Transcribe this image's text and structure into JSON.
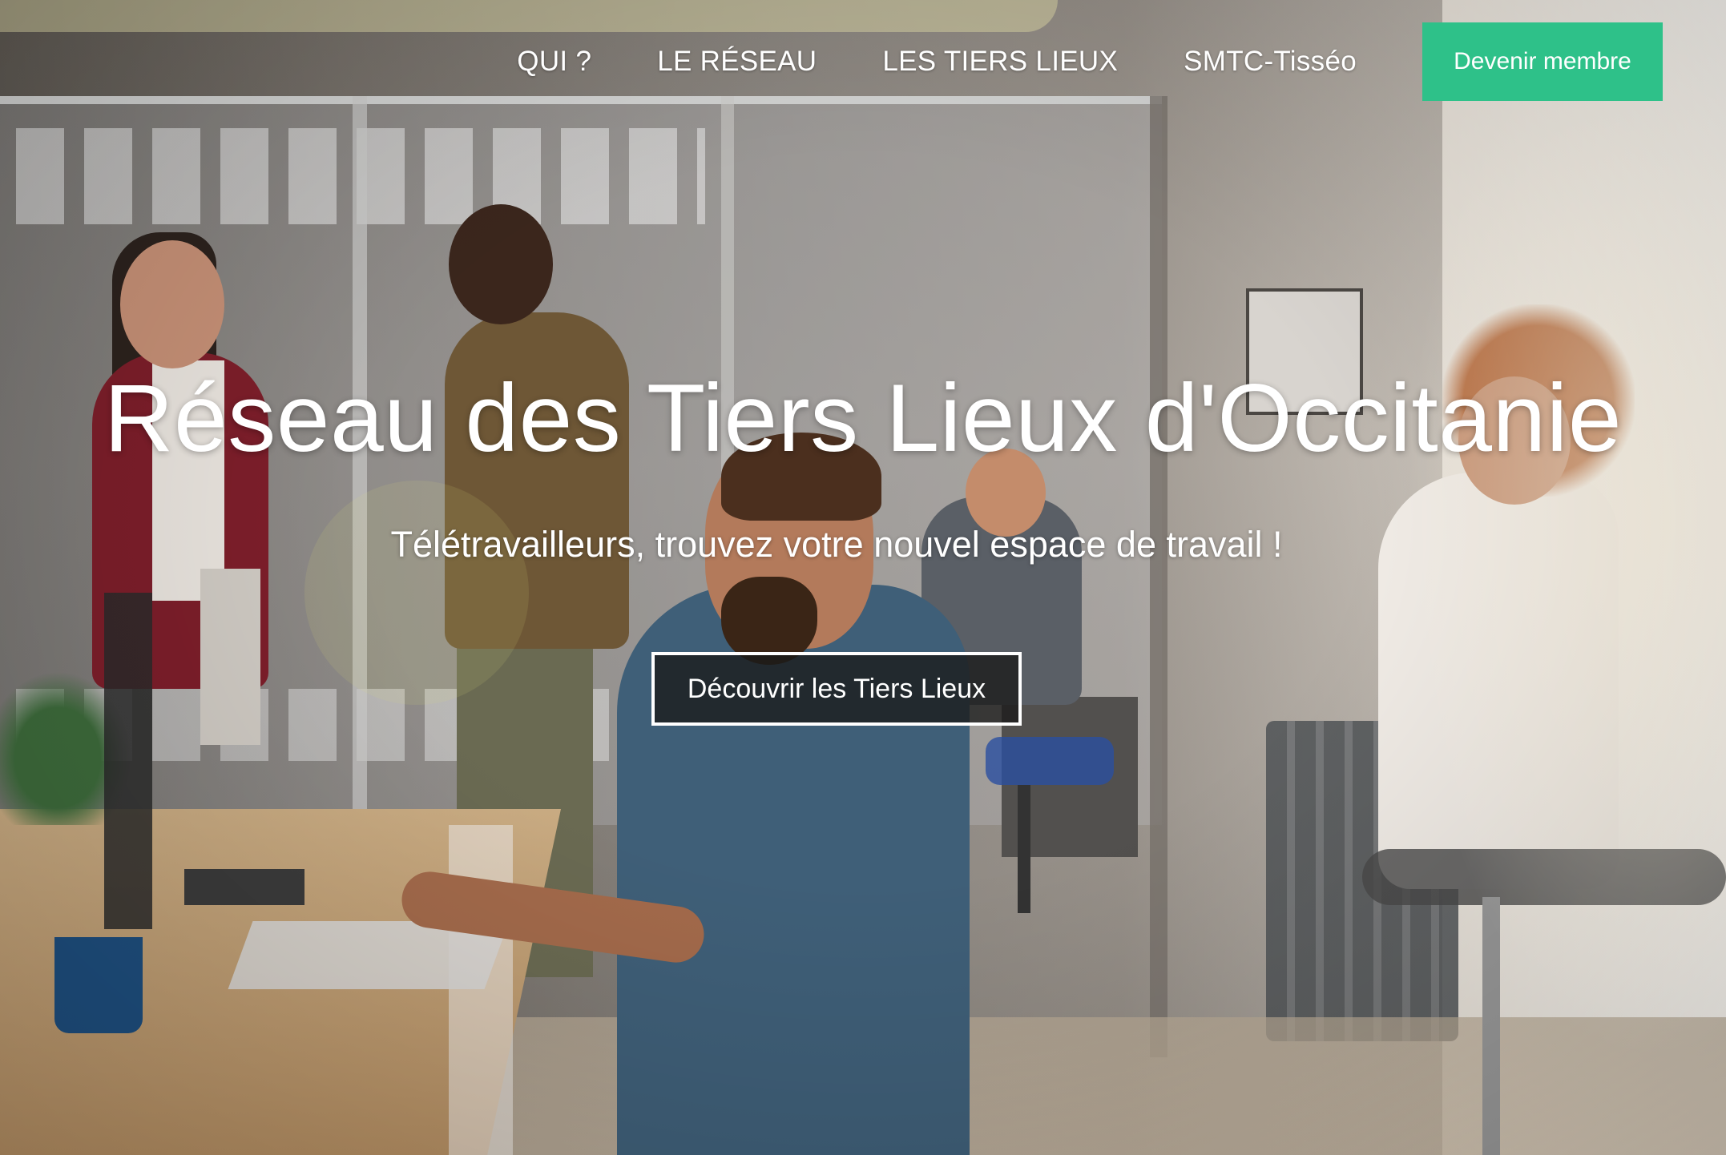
{
  "nav": {
    "items": [
      {
        "label": "QUI ?"
      },
      {
        "label": "LE RÉSEAU"
      },
      {
        "label": "LES TIERS LIEUX"
      },
      {
        "label": "SMTC-Tisséo"
      }
    ],
    "cta_label": "Devenir membre"
  },
  "hero": {
    "title": "Réseau des Tiers Lieux d'Occitanie",
    "subtitle": "Télétravailleurs, trouvez votre nouvel espace de travail !",
    "cta_label": "Découvrir les Tiers Lieux",
    "background_image": "coworking-office-photo"
  },
  "colors": {
    "accent": "#2ec189",
    "text": "#ffffff",
    "cta_background": "#191919"
  }
}
